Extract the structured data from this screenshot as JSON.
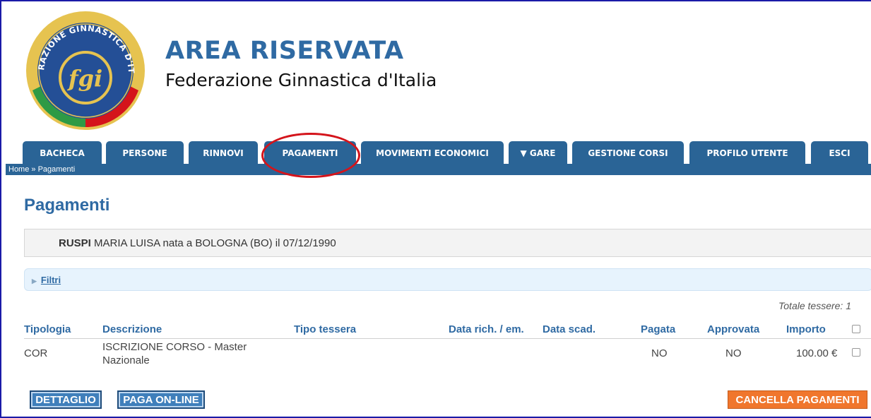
{
  "brand": {
    "title": "AREA RISERVATA",
    "subtitle": "Federazione Ginnastica d'Italia",
    "logo_text": "FEDERAZIONE GINNASTICA D'ITALIA",
    "logo_mark": "fgi"
  },
  "nav": {
    "tabs": [
      {
        "label": "BACHECA"
      },
      {
        "label": "PERSONE"
      },
      {
        "label": "RINNOVI"
      },
      {
        "label": "PAGAMENTI",
        "highlighted": true
      },
      {
        "label": "MOVIMENTI ECONOMICI"
      },
      {
        "label": "▼ GARE"
      },
      {
        "label": "GESTIONE CORSI"
      },
      {
        "label": "PROFILO UTENTE"
      },
      {
        "label": "ESCI"
      }
    ],
    "breadcrumb": "Home » Pagamenti"
  },
  "page": {
    "title": "Pagamenti",
    "person": {
      "surname": "RUSPI",
      "details": "MARIA LUISA nata a BOLOGNA (BO) il 07/12/1990"
    },
    "filters_label": "Filtri",
    "totals": "Totale tessere: 1"
  },
  "table": {
    "headers": [
      "Tipologia",
      "Descrizione",
      "Tipo tessera",
      "Data rich. / em.",
      "Data scad.",
      "Pagata",
      "Approvata",
      "Importo"
    ],
    "rows": [
      {
        "tipologia": "COR",
        "descrizione_l1": "ISCRIZIONE CORSO - Master",
        "descrizione_l2": "Nazionale",
        "tipo_tessera": "",
        "data_rich": "",
        "data_scad": "",
        "pagata": "NO",
        "approvata": "NO",
        "importo": "100.00 €"
      }
    ]
  },
  "actions": {
    "dettaglio": "DETTAGLIO",
    "paga_online": "PAGA ON-LINE",
    "cancella": "CANCELLA PAGAMENTI"
  },
  "colors": {
    "primary": "#2a6496",
    "accent_text": "#2f6aa3",
    "danger": "#f0762d",
    "highlight_circle": "#d4141b"
  }
}
